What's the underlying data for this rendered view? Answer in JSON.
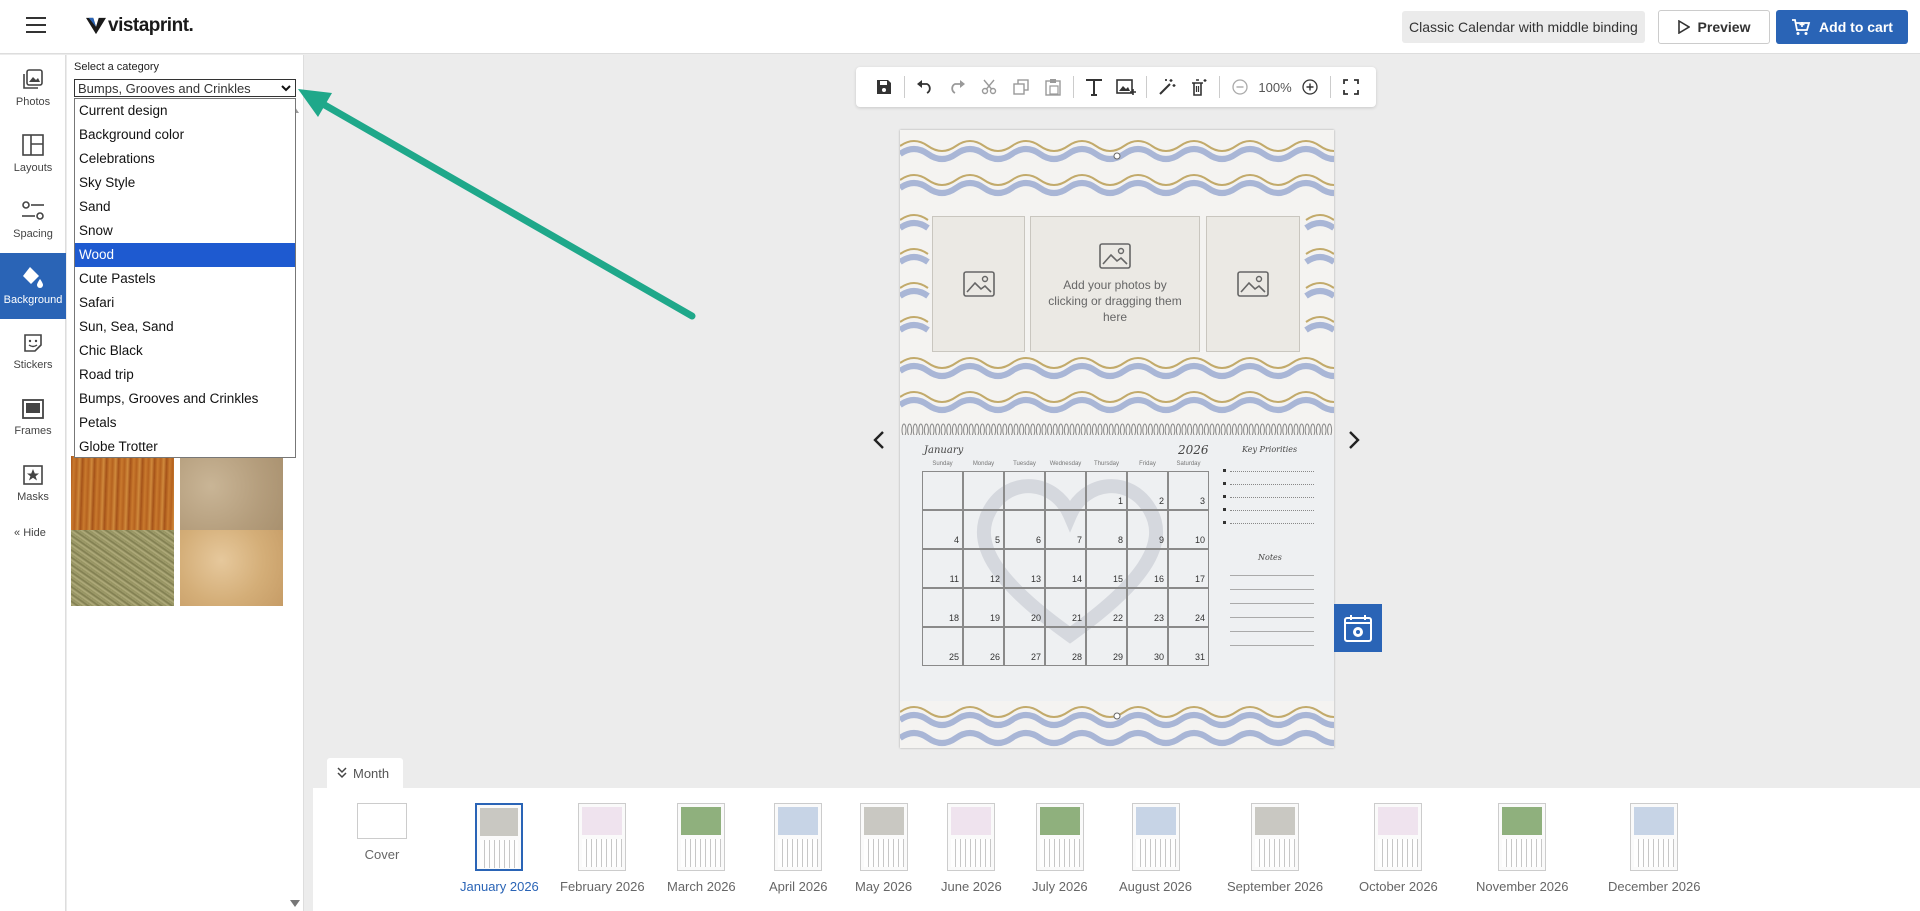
{
  "header": {
    "logo_text": "vistaprint.",
    "product_name": "Classic Calendar with middle binding",
    "preview_label": "Preview",
    "cart_label": "Add to cart"
  },
  "rail": {
    "items": [
      {
        "label": "Photos"
      },
      {
        "label": "Layouts"
      },
      {
        "label": "Spacing"
      },
      {
        "label": "Background"
      },
      {
        "label": "Stickers"
      },
      {
        "label": "Frames"
      },
      {
        "label": "Masks"
      }
    ],
    "active": "Background",
    "hide_label": "Hide"
  },
  "panel": {
    "label": "Select a category",
    "selected_category": "Bumps, Grooves and Crinkles",
    "options": [
      "Current design",
      "Background color",
      "Celebrations",
      "Sky Style",
      "Sand",
      "Snow",
      "Wood",
      "Cute Pastels",
      "Safari",
      "Sun, Sea, Sand",
      "Chic Black",
      "Road trip",
      "Bumps, Grooves and Crinkles",
      "Petals",
      "Globe Trotter"
    ],
    "highlighted_option": "Wood",
    "swatch_colors": [
      "#b8651d",
      "#bfa98a",
      "#9c9a6a",
      "#d8b98c"
    ]
  },
  "toolbar": {
    "zoom": "100%"
  },
  "canvas": {
    "photo_hint": "Add your photos by clicking or dragging them here",
    "calendar": {
      "month": "January",
      "year": "2026",
      "days_of_week": [
        "Sunday",
        "Monday",
        "Tuesday",
        "Wednesday",
        "Thursday",
        "Friday",
        "Saturday"
      ],
      "rows": [
        [
          "",
          "",
          "",
          "",
          "1",
          "2",
          "3"
        ],
        [
          "4",
          "5",
          "6",
          "7",
          "8",
          "9",
          "10"
        ],
        [
          "11",
          "12",
          "13",
          "14",
          "15",
          "16",
          "17"
        ],
        [
          "18",
          "19",
          "20",
          "21",
          "22",
          "23",
          "24"
        ],
        [
          "25",
          "26",
          "27",
          "28",
          "29",
          "30",
          "31"
        ]
      ],
      "side_title_1": "Key Priorities",
      "side_title_2": "Notes"
    }
  },
  "strip": {
    "tab_label": "Month",
    "cover_label": "Cover",
    "months": [
      {
        "label": "January 2026",
        "selected": true,
        "color": "#c9c8c2"
      },
      {
        "label": "February 2026",
        "selected": false,
        "color": "#efe3ee"
      },
      {
        "label": "March 2026",
        "selected": false,
        "color": "#8fb07d"
      },
      {
        "label": "April 2026",
        "selected": false,
        "color": "#c7d4e6"
      },
      {
        "label": "May 2026",
        "selected": false,
        "color": "#c9c8c2"
      },
      {
        "label": "June 2026",
        "selected": false,
        "color": "#efe3ee"
      },
      {
        "label": "July 2026",
        "selected": false,
        "color": "#8fb07d"
      },
      {
        "label": "August 2026",
        "selected": false,
        "color": "#c7d4e6"
      },
      {
        "label": "September 2026",
        "selected": false,
        "color": "#c9c8c2"
      },
      {
        "label": "October 2026",
        "selected": false,
        "color": "#efe3ee"
      },
      {
        "label": "November 2026",
        "selected": false,
        "color": "#8fb07d"
      },
      {
        "label": "December 2026",
        "selected": false,
        "color": "#c7d4e6"
      }
    ]
  },
  "colors": {
    "accent": "#2a64b6",
    "annotation_arrow": "#1fa88a",
    "dropdown_highlight": "#1e5ad0"
  }
}
